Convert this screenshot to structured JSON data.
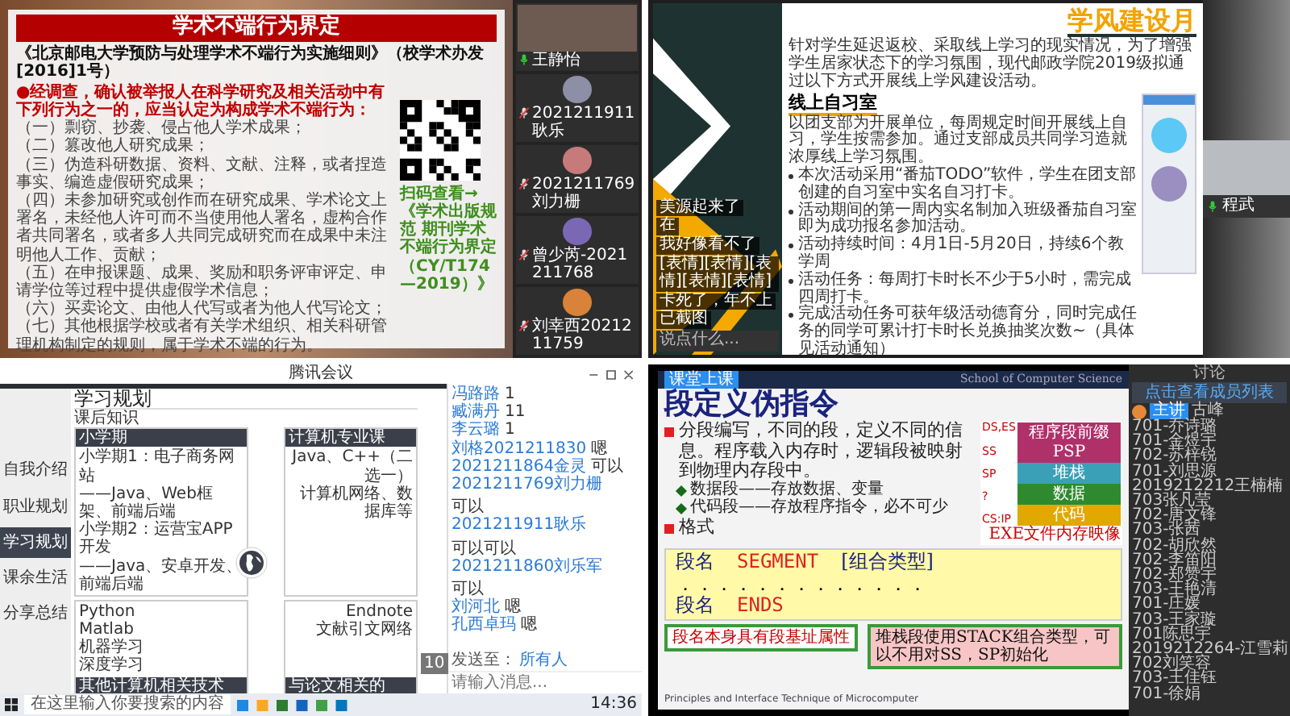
{
  "meeting_1": {
    "slide": {
      "title": "学术不端行为界定",
      "source": "《北京邮电大学预防与处理学术不端行为实施细则》（校学术办发[2016]1号）",
      "intro": "●经调查，确认被举报人在科学研究及相关活动中有下列行为之一的，应当认定为构成学术不端行为：",
      "items": [
        "（一）剽窃、抄袭、侵占他人学术成果；",
        "（二）篡改他人研究成果；",
        "（三）伪造科研数据、资料、文献、注释，或者捏造事实、编造虚假研究成果；",
        "（四）未参加研究或创作而在研究成果、学术论文上署名，未经他人许可而不当使用他人署名，虚构合作者共同署名，或者多人共同完成研究而在成果中未注明他人工作、贡献；",
        "（五）在申报课题、成果、奖励和职务评审评定、申请学位等过程中提供虚假学术信息；",
        "（六）买卖论文、由他人代写或者为他人代写论文；",
        "（七）其他根据学校或者有关学术组织、相关科研管理机构制定的规则，属于学术不端的行为。"
      ],
      "qr_caption": "扫码查看→《学术出版规范 期刊学术不端行为界定（CY/T174—2019）》"
    },
    "participants": [
      {
        "name": "王静怡",
        "muted": false,
        "video": true
      },
      {
        "name": "2021211911耿乐",
        "muted": true,
        "video": false
      },
      {
        "name": "2021211769刘力栅",
        "muted": true,
        "video": false
      },
      {
        "name": "曾少芮-2021211768",
        "muted": true,
        "video": false
      },
      {
        "name": "刘幸西2021211759",
        "muted": true,
        "video": false
      }
    ]
  },
  "meeting_2": {
    "chat": [
      {
        "text": "美源起来了"
      },
      {
        "text": "在"
      },
      {
        "text": "我好像看不了"
      },
      {
        "text": "[表情][表情][表情][表情][表情]"
      },
      {
        "text": "卡死了，年不上"
      },
      {
        "text": "已截图"
      }
    ],
    "chat_input": {
      "placeholder": "说点什么..."
    },
    "slide": {
      "title": "学风建设月",
      "intro": "针对学生延迟返校、采取线上学习的现实情况，为了增强学生居家状态下的学习氛围，现代邮政学院2019级拟通过以下方式开展线上学风建设活动。",
      "heading": "线上自习室",
      "paragraph": "以团支部为开展单位，每周规定时间开展线上自习，学生按需参加。通过支部成员共同学习造就浓厚线上学习氛围。",
      "bullets": [
        "本次活动采用“番茄TODO”软件，学生在团支部创建的自习室中实名自习打卡。",
        "活动期间的第一周内实名制加入班级番茄自习室即为成功报名参加活动。",
        "活动持续时间：4月1日-5月20日，持续6个教学周",
        "活动任务：每周打卡时长不少于5小时，需完成四周打卡。",
        "完成活动任务可获年级活动德育分，同时完成任务的同学可累计打卡时长兑换抽奖次数~（具体见活动通知）"
      ]
    },
    "video": {
      "name": "程武",
      "muted": false
    }
  },
  "meeting_3": {
    "window_title": "腾讯会议",
    "nav": [
      {
        "label": "自我介绍",
        "selected": false
      },
      {
        "label": "职业规划",
        "selected": false
      },
      {
        "label": "学习规划",
        "selected": true
      },
      {
        "label": "课余生活",
        "selected": false
      },
      {
        "label": "分享总结",
        "selected": false
      }
    ],
    "slide": {
      "title": "学习规划",
      "subtitle": "课后知识",
      "page": "10",
      "boxes": [
        {
          "header": "小学期",
          "lines": [
            "小学期1：电子商务网站",
            "——Java、Web框架、前端后端",
            "小学期2：运营宝APP开发",
            "——Java、安卓开发、前端后端"
          ]
        },
        {
          "header": "计算机专业课",
          "lines": [
            "Java、C++（二选一）",
            "计算机网络、数据库等"
          ]
        },
        {
          "header": "其他计算机相关技术",
          "lines": [
            "Python",
            "Matlab",
            "机器学习",
            "深度学习"
          ]
        },
        {
          "header": "与论文相关的",
          "lines": [
            "Endnote",
            "文献引文网络"
          ]
        }
      ]
    },
    "chat": {
      "messages": [
        {
          "sender": "冯路路",
          "text": "1"
        },
        {
          "sender": "臧满丹",
          "text": "11"
        },
        {
          "sender": "李云璐",
          "text": "1"
        },
        {
          "sender": "刘格2021211830",
          "text": "嗯"
        },
        {
          "sender": "2021211864金灵",
          "text": "可以"
        },
        {
          "sender": "2021211769刘力栅",
          "text": "可以"
        },
        {
          "sender": "2021211911耿乐",
          "text": "可以可以"
        },
        {
          "sender": "2021211860刘乐军",
          "text": "可以"
        },
        {
          "sender": "刘河北",
          "text": "嗯"
        },
        {
          "sender": "孔西卓玛",
          "text": "嗯"
        }
      ],
      "send_to_label": "发送至：",
      "send_to": "所有人",
      "placeholder": "请输入消息..."
    },
    "taskbar": {
      "search_placeholder": "在这里输入你要搜索的内容",
      "time": "14:36"
    }
  },
  "meeting_4": {
    "badge": "课堂上课",
    "slide": {
      "school": "School of Computer Science",
      "title": "段定义伪指令",
      "bullets": [
        {
          "kind": "main",
          "text": "分段编写，不同的段，定义不同的信息。程序载入内存时，逻辑段被映射到物理内存段中。"
        },
        {
          "kind": "sub",
          "text": "数据段——存放数据、变量"
        },
        {
          "kind": "sub",
          "text": "代码段——存放程序指令，必不可少"
        },
        {
          "kind": "main",
          "text": "格式"
        }
      ],
      "code": [
        {
          "name": "段名",
          "keyword": "SEGMENT",
          "operand": "[组合类型]"
        },
        {
          "dots": "．．．．．．．．．．．．．"
        },
        {
          "name": "段名",
          "keyword": "ENDS"
        }
      ],
      "callouts": [
        {
          "kind": "note",
          "text": "段名本身具有段基址属性"
        },
        {
          "kind": "warning",
          "text": "堆栈段使用STACK组合类型，可以不用对SS，SP初始化"
        }
      ],
      "diagram": {
        "segments": [
          {
            "label": "程序段前缀PSP",
            "color": "#b0306a"
          },
          {
            "label": "堆栈",
            "color": "#3aa0b8"
          },
          {
            "label": "数据",
            "color": "#2f8a2f"
          },
          {
            "label": "代码",
            "color": "#e0a800"
          }
        ],
        "pointers": [
          "DS,ES",
          "SS",
          "SP",
          "?",
          "CS:IP"
        ],
        "caption": "EXE文件内存映像"
      },
      "footer": "Principles and Interface Technique of Microcomputer"
    },
    "sidebar": {
      "title": "讨论",
      "members_button": "点击查看成员列表",
      "host": {
        "role": "主讲",
        "name": "古峰"
      },
      "messages": [
        "701-乔诗璐",
        "701-金煜宇",
        "702-苏梓锐",
        "701-刘思源",
        "2019212212王楠楠",
        "703张凡莹",
        "702-唐文锋",
        "703-张茜",
        "702-胡欣然",
        "702-李笛阳",
        "702-郑赞宇",
        "703-王艳清",
        "701-庄媛",
        "703-王家璇",
        "701陈思宇",
        "2019212264-江雪莉",
        "702刘笑容",
        "703-王佳钰",
        "701-徐娟"
      ]
    }
  }
}
